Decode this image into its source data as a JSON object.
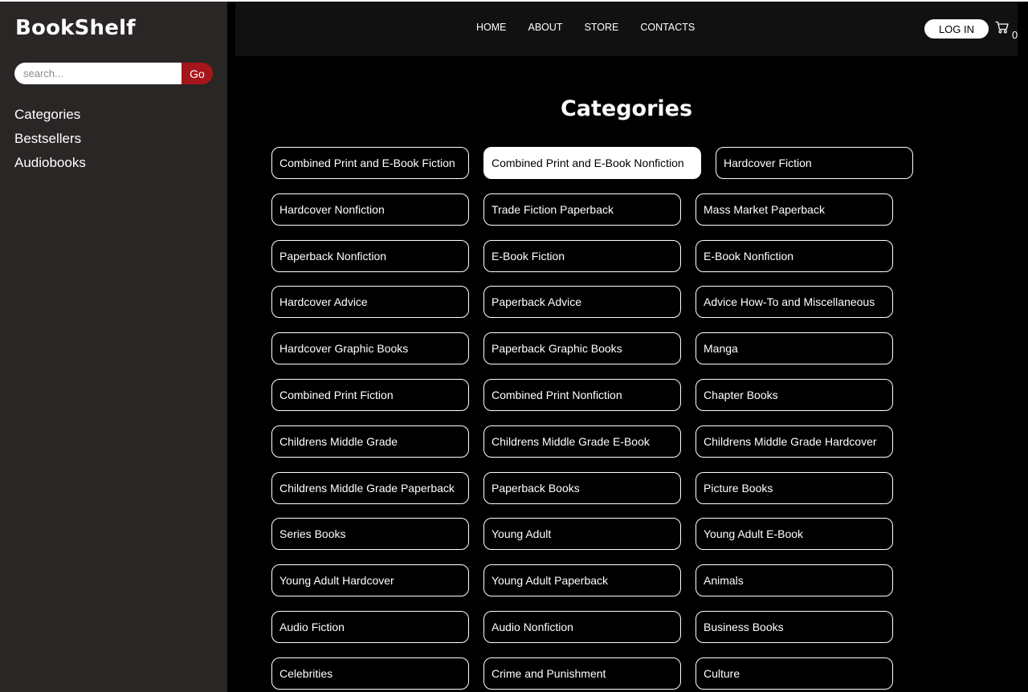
{
  "brand": "BookShelf",
  "search": {
    "placeholder": "search...",
    "button_label": "Go"
  },
  "sidebar": {
    "items": [
      {
        "label": "Categories"
      },
      {
        "label": "Bestsellers"
      },
      {
        "label": "Audiobooks"
      }
    ]
  },
  "topnav": {
    "links": [
      {
        "label": "HOME"
      },
      {
        "label": "ABOUT"
      },
      {
        "label": "STORE"
      },
      {
        "label": "CONTACTS"
      }
    ],
    "login_label": "LOG IN",
    "cart_count": "0"
  },
  "main": {
    "title": "Categories",
    "active_category": "Combined Print and E-Book Nonfiction",
    "categories": [
      "Combined Print and E-Book Fiction",
      "Combined Print and E-Book Nonfiction",
      "Hardcover Fiction",
      "Hardcover Nonfiction",
      "Trade Fiction Paperback",
      "Mass Market Paperback",
      "Paperback Nonfiction",
      "E-Book Fiction",
      "E-Book Nonfiction",
      "Hardcover Advice",
      "Paperback Advice",
      "Advice How-To and Miscellaneous",
      "Hardcover Graphic Books",
      "Paperback Graphic Books",
      "Manga",
      "Combined Print Fiction",
      "Combined Print Nonfiction",
      "Chapter Books",
      "Childrens Middle Grade",
      "Childrens Middle Grade E-Book",
      "Childrens Middle Grade Hardcover",
      "Childrens Middle Grade Paperback",
      "Paperback Books",
      "Picture Books",
      "Series Books",
      "Young Adult",
      "Young Adult E-Book",
      "Young Adult Hardcover",
      "Young Adult Paperback",
      "Animals",
      "Audio Fiction",
      "Audio Nonfiction",
      "Business Books",
      "Celebrities",
      "Crime and Punishment",
      "Culture"
    ]
  },
  "colors": {
    "sidebar_bg": "#2a2625",
    "page_bg": "#000000",
    "topbar_bg": "#111111",
    "accent": "#a5161b"
  },
  "icons": {
    "cart": "cart-icon"
  }
}
